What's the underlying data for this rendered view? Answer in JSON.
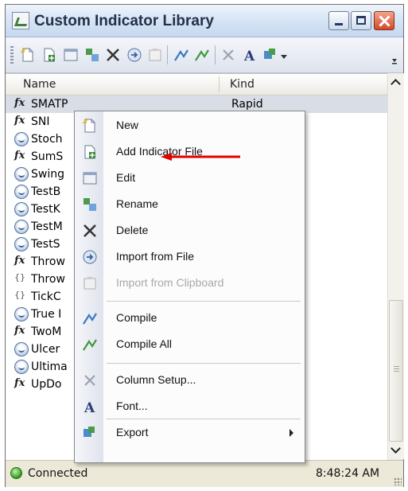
{
  "window": {
    "title": "Custom Indicator Library"
  },
  "toolbar": {
    "icons": [
      "new-icon",
      "add-file-icon",
      "edit-icon",
      "rename-icon",
      "delete-icon",
      "import-file-icon",
      "import-clipboard-icon",
      "compile-icon",
      "compile-all-icon",
      "column-setup-icon",
      "font-icon",
      "export-icon"
    ]
  },
  "list": {
    "columns": [
      "Name",
      "Kind"
    ],
    "rows": [
      {
        "icon": "fx-icon",
        "name": "SMATP",
        "kind": "Rapid"
      },
      {
        "icon": "fx-icon",
        "name": "SNI",
        "kind": ""
      },
      {
        "icon": "indicator-icon",
        "name": "Stoch",
        "kind": ""
      },
      {
        "icon": "fx-icon",
        "name": "SumS",
        "kind": ""
      },
      {
        "icon": "indicator-icon",
        "name": "Swing",
        "kind": ""
      },
      {
        "icon": "indicator-icon",
        "name": "TestB",
        "kind": ""
      },
      {
        "icon": "indicator-icon",
        "name": "TestK",
        "kind": ""
      },
      {
        "icon": "indicator-icon",
        "name": "TestM",
        "kind": ""
      },
      {
        "icon": "indicator-icon",
        "name": "TestS",
        "kind": ""
      },
      {
        "icon": "fx-icon",
        "name": "Throw",
        "kind": ""
      },
      {
        "icon": "header-icon",
        "name": "Throw",
        "kind": ""
      },
      {
        "icon": "header-icon",
        "name": "TickC",
        "kind": ""
      },
      {
        "icon": "indicator-icon",
        "name": "True I",
        "kind": ""
      },
      {
        "icon": "fx-icon",
        "name": "TwoM",
        "kind": ""
      },
      {
        "icon": "indicator-icon",
        "name": "Ulcer",
        "kind": ""
      },
      {
        "icon": "indicator-icon",
        "name": "Ultima",
        "kind": ""
      },
      {
        "icon": "fx-icon",
        "name": "UpDo",
        "kind": ""
      }
    ]
  },
  "context_menu": {
    "items": [
      {
        "label": "New",
        "icon": "new-icon",
        "enabled": true
      },
      {
        "label": "Add Indicator File",
        "icon": "add-file-icon",
        "enabled": true
      },
      {
        "label": "Edit",
        "icon": "edit-icon",
        "enabled": true
      },
      {
        "label": "Rename",
        "icon": "rename-icon",
        "enabled": true
      },
      {
        "label": "Delete",
        "icon": "delete-icon",
        "enabled": true
      },
      {
        "label": "Import from File",
        "icon": "import-file-icon",
        "enabled": true
      },
      {
        "label": "Import from Clipboard",
        "icon": "import-clipboard-icon",
        "enabled": false
      },
      {
        "label": "Compile",
        "icon": "compile-icon",
        "enabled": true
      },
      {
        "label": "Compile All",
        "icon": "compile-all-icon",
        "enabled": true
      },
      {
        "label": "Column Setup...",
        "icon": "column-setup-icon",
        "enabled": true
      },
      {
        "label": "Font...",
        "icon": "font-icon",
        "enabled": true
      },
      {
        "label": "Export",
        "icon": "export-icon",
        "enabled": true,
        "submenu": true
      }
    ]
  },
  "status": {
    "text": "Connected",
    "time": "8:48:24 AM",
    "indicator_color": "#2f9a1f"
  },
  "annotation": {
    "color": "#e00000",
    "icon": "red-arrow-icon"
  }
}
